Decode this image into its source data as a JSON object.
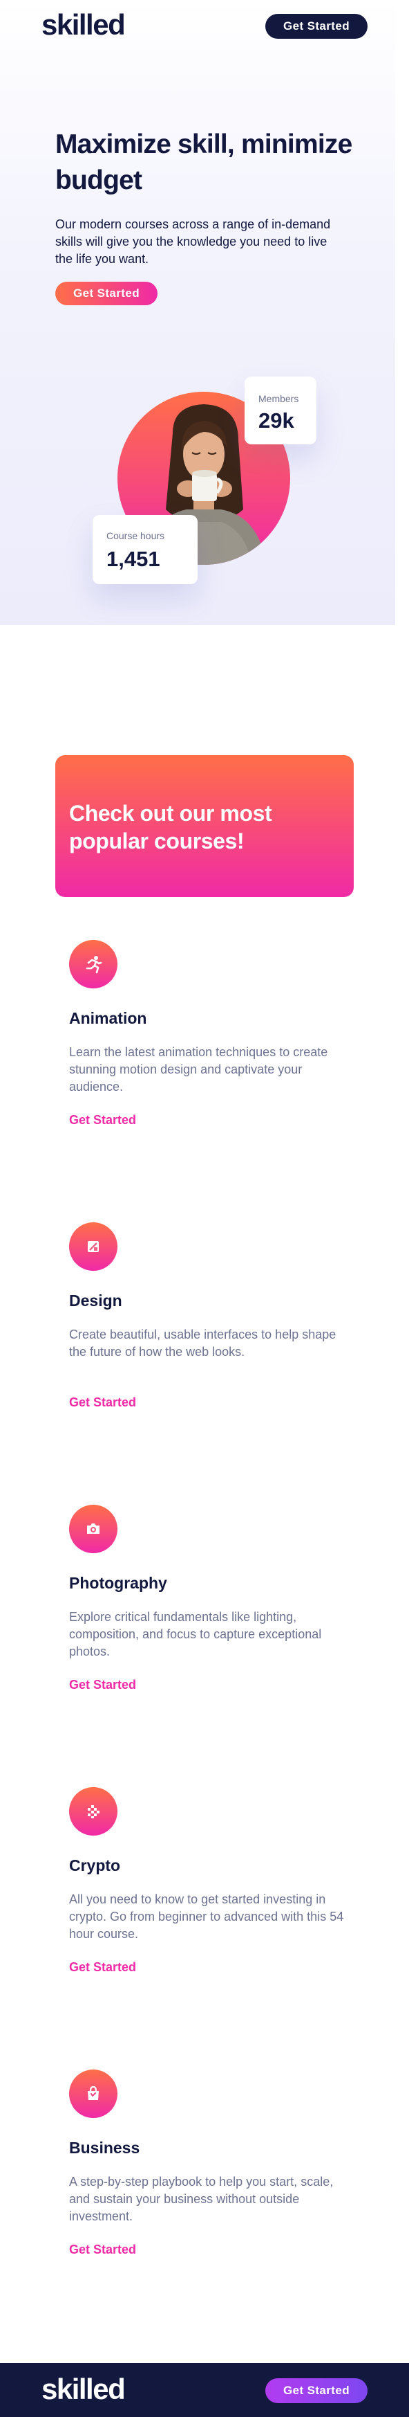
{
  "header": {
    "logo": "skilled",
    "cta_label": "Get Started"
  },
  "hero": {
    "title": "Maximize skill, minimize budget",
    "text": "Our modern courses across a range of in-demand skills will give you the knowledge you need to live the life you want.",
    "cta_label": "Get Started",
    "members_label": "Members",
    "members_value": "29k",
    "hours_label": "Course hours",
    "hours_value": "1,451"
  },
  "promo": {
    "title": "Check out our most popular courses!"
  },
  "courses": [
    {
      "icon": "running-figure-icon",
      "title": "Animation",
      "desc": "Learn the latest animation techniques to create stunning motion design and captivate your audience.",
      "link": "Get Started"
    },
    {
      "icon": "design-frame-icon",
      "title": "Design",
      "desc": "Create beautiful, usable interfaces to help shape the future of how the web looks.",
      "link": "Get Started"
    },
    {
      "icon": "camera-icon",
      "title": "Photography",
      "desc": "Explore critical fundamentals like lighting, composition, and focus to capture exceptional photos.",
      "link": "Get Started"
    },
    {
      "icon": "crypto-grid-icon",
      "title": "Crypto",
      "desc": "All you need to know to get started investing in crypto. Go from beginner to advanced with this 54 hour course.",
      "link": "Get Started"
    },
    {
      "icon": "shopping-bag-icon",
      "title": "Business",
      "desc": "A step-by-step playbook to help you start, scale, and sustain your business without outside investment.",
      "link": "Get Started"
    }
  ],
  "footer": {
    "logo": "skilled",
    "cta_label": "Get Started"
  },
  "colors": {
    "navy": "#13183f",
    "accent_orange": "#ff6f48",
    "accent_pink": "#f02aa6",
    "accent_purple": "#b23cf0",
    "text_muted": "#6c7290"
  }
}
